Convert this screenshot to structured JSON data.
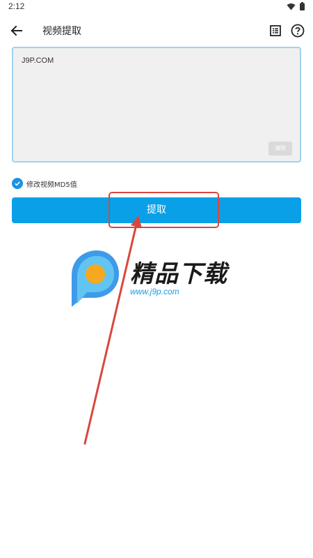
{
  "status_bar": {
    "time": "2:12"
  },
  "app_bar": {
    "title": "视频提取"
  },
  "url_input": {
    "value": "J9P.COM",
    "clear_label": "清除"
  },
  "option": {
    "label": "修改视频MD5值",
    "checked": true
  },
  "extract_button": {
    "label": "提取"
  },
  "watermark": {
    "title": "精品下载",
    "url": "www.j9p.com"
  },
  "colors": {
    "accent": "#0aa0e7",
    "checkbox": "#1a93e6",
    "annotation": "#d9473c",
    "input_border": "#9fd2ee"
  },
  "icons": {
    "back": "arrow-left-icon",
    "list": "list-icon",
    "help": "help-icon",
    "wifi": "wifi-icon",
    "battery": "battery-icon",
    "check": "check-icon"
  }
}
